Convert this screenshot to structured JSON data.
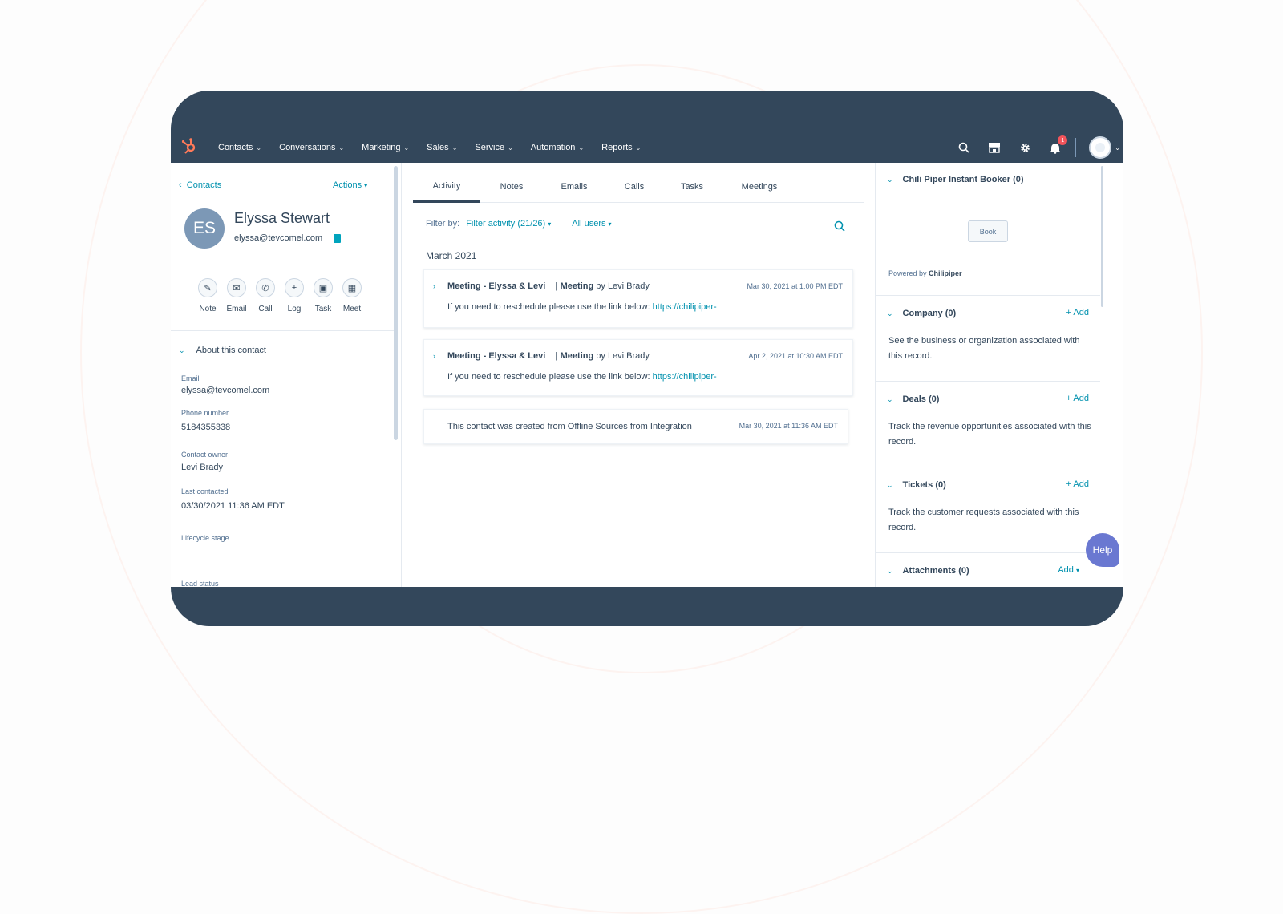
{
  "nav": {
    "items": [
      "Contacts",
      "Conversations",
      "Marketing",
      "Sales",
      "Service",
      "Automation",
      "Reports"
    ],
    "notification_count": "1"
  },
  "left": {
    "back": "Contacts",
    "actions": "Actions",
    "initials": "ES",
    "name": "Elyssa Stewart",
    "email": "elyssa@tevcomel.com",
    "quick_actions": [
      "Note",
      "Email",
      "Call",
      "Log",
      "Task",
      "Meet"
    ],
    "about_title": "About this contact",
    "props": {
      "email_label": "Email",
      "email_value": "elyssa@tevcomel.com",
      "phone_label": "Phone number",
      "phone_value": "5184355338",
      "owner_label": "Contact owner",
      "owner_value": "Levi Brady",
      "last_label": "Last contacted",
      "last_value": "03/30/2021 11:36 AM EDT",
      "lifecycle_label": "Lifecycle stage",
      "lead_label": "Lead status"
    }
  },
  "middle": {
    "tabs": [
      "Activity",
      "Notes",
      "Emails",
      "Calls",
      "Tasks",
      "Meetings"
    ],
    "filter_label": "Filter by:",
    "filter_activity": "Filter activity (21/26)",
    "all_users": "All users",
    "month": "March 2021",
    "cards": [
      {
        "title": "Meeting - Elyssa & Levi",
        "type": "| Meeting",
        "by": "by Levi Brady",
        "date": "Mar 30, 2021 at 1:00 PM EDT",
        "body": "If you need to reschedule please use the link below:",
        "link": "https://chilipiper-"
      },
      {
        "title": "Meeting - Elyssa & Levi",
        "type": "| Meeting",
        "by": "by Levi Brady",
        "date": "Apr 2, 2021 at 10:30 AM EDT",
        "body": "If you need to reschedule please use the link below:",
        "link": "https://chilipiper-"
      }
    ],
    "created": {
      "text": "This contact was created from Offline Sources from Integration",
      "date": "Mar 30, 2021 at 11:36 AM EDT"
    }
  },
  "right": {
    "chili": {
      "title": "Chili Piper Instant Booker (0)",
      "book": "Book",
      "powered": "Powered by",
      "brand": "Chilipiper"
    },
    "company": {
      "title": "Company (0)",
      "add": "+ Add",
      "desc": "See the business or organization associated with this record."
    },
    "deals": {
      "title": "Deals (0)",
      "add": "+ Add",
      "desc": "Track the revenue opportunities associated with this record."
    },
    "tickets": {
      "title": "Tickets (0)",
      "add": "+ Add",
      "desc": "Track the customer requests associated with this record."
    },
    "attachments": {
      "title": "Attachments (0)",
      "add": "Add"
    }
  },
  "help": "Help",
  "colors": {
    "nav_bg": "#33475b",
    "link": "#0091ae",
    "brand": "#ff7a59",
    "help": "#6a78d1"
  }
}
